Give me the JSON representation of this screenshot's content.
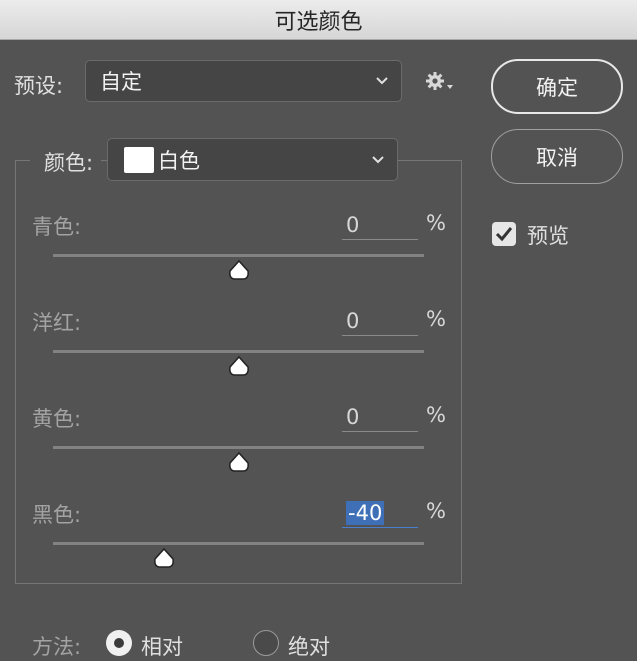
{
  "window": {
    "title": "可选颜色"
  },
  "preset": {
    "label": "预设:",
    "value": "自定"
  },
  "buttons": {
    "ok": "确定",
    "cancel": "取消"
  },
  "preview": {
    "label": "预览",
    "checked": true
  },
  "color": {
    "label": "颜色:",
    "value": "白色",
    "swatch": "#ffffff"
  },
  "sliders": [
    {
      "label": "青色:",
      "value": "0",
      "unit": "%",
      "level": 0
    },
    {
      "label": "洋红:",
      "value": "0",
      "unit": "%",
      "level": 0
    },
    {
      "label": "黄色:",
      "value": "0",
      "unit": "%",
      "level": 0
    },
    {
      "label": "黑色:",
      "value": "-40",
      "unit": "%",
      "level": -40
    }
  ],
  "method": {
    "label": "方法:",
    "options": [
      {
        "label": "相对",
        "selected": true
      },
      {
        "label": "绝对",
        "selected": false
      }
    ]
  },
  "colors": {
    "background": "#535353",
    "selection": "#3e6fb7"
  }
}
